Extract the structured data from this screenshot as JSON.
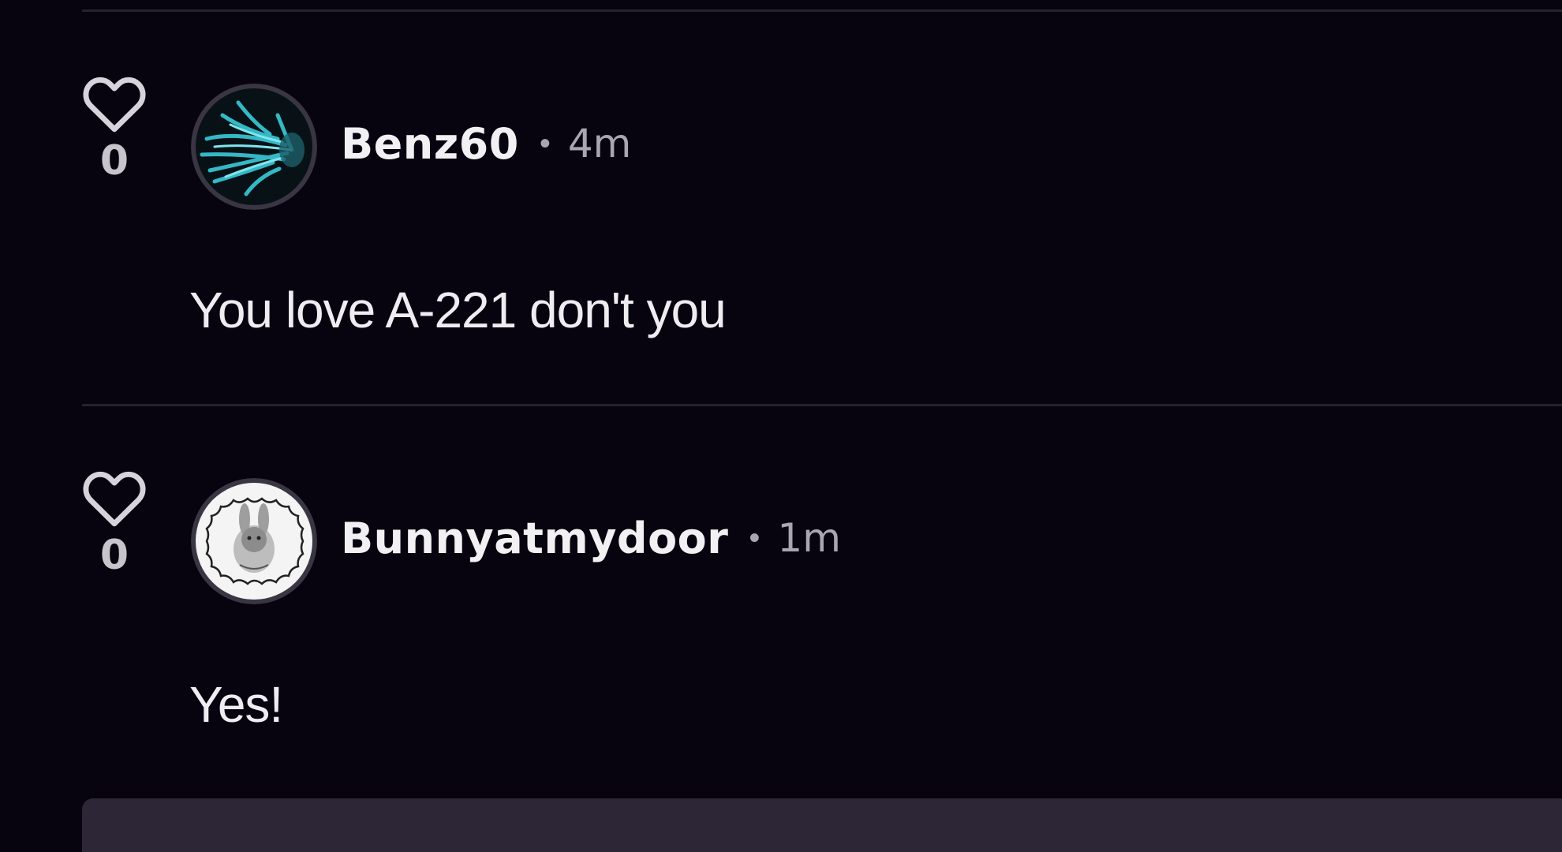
{
  "comments": [
    {
      "likes": "0",
      "username": "Benz60",
      "separator": "•",
      "time": "4m",
      "text": "You love A-221 don't you",
      "avatar_icon": "teal-abstract-avatar"
    },
    {
      "likes": "0",
      "username": "Bunnyatmydoor",
      "separator": "•",
      "time": "1m",
      "text": "Yes!",
      "avatar_icon": "bunny-sketch-avatar"
    }
  ],
  "colors": {
    "background": "#07030f",
    "divider": "#25212e",
    "reply_box": "#2c2637",
    "text_primary": "#f1f0f3",
    "text_muted": "#a9a6b0"
  }
}
